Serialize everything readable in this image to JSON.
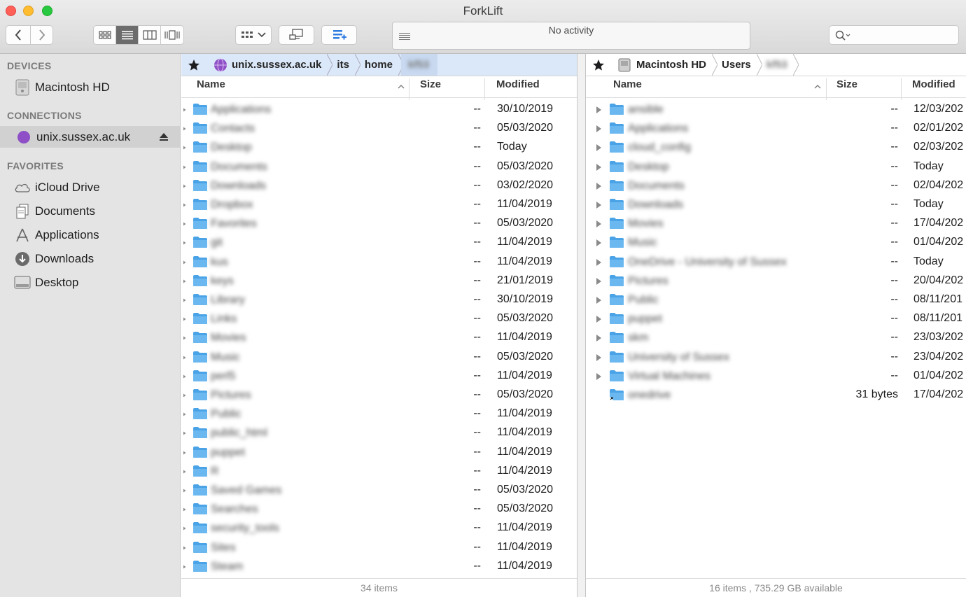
{
  "window": {
    "title": "ForkLift"
  },
  "toolbar": {
    "activity_text": "No activity",
    "search_placeholder": ""
  },
  "sidebar": {
    "sections": [
      {
        "heading": "DEVICES",
        "items": [
          {
            "label": "Macintosh HD",
            "icon": "hard-drive-icon"
          }
        ]
      },
      {
        "heading": "CONNECTIONS",
        "items": [
          {
            "label": "unix.sussex.ac.uk",
            "icon": "globe-icon",
            "selected": true,
            "eject": true
          }
        ]
      },
      {
        "heading": "FAVORITES",
        "items": [
          {
            "label": "iCloud Drive",
            "icon": "cloud-icon"
          },
          {
            "label": "Documents",
            "icon": "documents-icon"
          },
          {
            "label": "Applications",
            "icon": "applications-icon"
          },
          {
            "label": "Downloads",
            "icon": "downloads-icon"
          },
          {
            "label": "Desktop",
            "icon": "desktop-icon"
          }
        ]
      }
    ]
  },
  "left_pane": {
    "path": [
      "unix.sussex.ac.uk",
      "its",
      "home",
      "kf53"
    ],
    "columns": {
      "name": "Name",
      "size": "Size",
      "modified": "Modified"
    },
    "rows": [
      {
        "name": "Applications",
        "size": "--",
        "modified": "30/10/2019"
      },
      {
        "name": "Contacts",
        "size": "--",
        "modified": "05/03/2020"
      },
      {
        "name": "Desktop",
        "size": "--",
        "modified": "Today"
      },
      {
        "name": "Documents",
        "size": "--",
        "modified": "05/03/2020"
      },
      {
        "name": "Downloads",
        "size": "--",
        "modified": "03/02/2020"
      },
      {
        "name": "Dropbox",
        "size": "--",
        "modified": "11/04/2019"
      },
      {
        "name": "Favorites",
        "size": "--",
        "modified": "05/03/2020"
      },
      {
        "name": "git",
        "size": "--",
        "modified": "11/04/2019"
      },
      {
        "name": "kus",
        "size": "--",
        "modified": "11/04/2019"
      },
      {
        "name": "keys",
        "size": "--",
        "modified": "21/01/2019"
      },
      {
        "name": "Library",
        "size": "--",
        "modified": "30/10/2019"
      },
      {
        "name": "Links",
        "size": "--",
        "modified": "05/03/2020"
      },
      {
        "name": "Movies",
        "size": "--",
        "modified": "11/04/2019"
      },
      {
        "name": "Music",
        "size": "--",
        "modified": "05/03/2020"
      },
      {
        "name": "perl5",
        "size": "--",
        "modified": "11/04/2019"
      },
      {
        "name": "Pictures",
        "size": "--",
        "modified": "05/03/2020"
      },
      {
        "name": "Public",
        "size": "--",
        "modified": "11/04/2019"
      },
      {
        "name": "public_html",
        "size": "--",
        "modified": "11/04/2019"
      },
      {
        "name": "puppet",
        "size": "--",
        "modified": "11/04/2019"
      },
      {
        "name": "R",
        "size": "--",
        "modified": "11/04/2019"
      },
      {
        "name": "Saved Games",
        "size": "--",
        "modified": "05/03/2020"
      },
      {
        "name": "Searches",
        "size": "--",
        "modified": "05/03/2020"
      },
      {
        "name": "security_tools",
        "size": "--",
        "modified": "11/04/2019"
      },
      {
        "name": "Sites",
        "size": "--",
        "modified": "11/04/2019"
      },
      {
        "name": "Steam",
        "size": "--",
        "modified": "11/04/2019"
      }
    ],
    "status": "34 items"
  },
  "right_pane": {
    "path": [
      "Macintosh HD",
      "Users",
      "kf53"
    ],
    "columns": {
      "name": "Name",
      "size": "Size",
      "modified": "Modified"
    },
    "rows": [
      {
        "name": "ansible",
        "size": "--",
        "modified": "12/03/202"
      },
      {
        "name": "Applications",
        "size": "--",
        "modified": "02/01/202"
      },
      {
        "name": "cloud_config",
        "size": "--",
        "modified": "02/03/202"
      },
      {
        "name": "Desktop",
        "size": "--",
        "modified": "Today"
      },
      {
        "name": "Documents",
        "size": "--",
        "modified": "02/04/202"
      },
      {
        "name": "Downloads",
        "size": "--",
        "modified": "Today"
      },
      {
        "name": "Movies",
        "size": "--",
        "modified": "17/04/202"
      },
      {
        "name": "Music",
        "size": "--",
        "modified": "01/04/202"
      },
      {
        "name": "OneDrive - University of Sussex",
        "size": "--",
        "modified": "Today"
      },
      {
        "name": "Pictures",
        "size": "--",
        "modified": "20/04/202"
      },
      {
        "name": "Public",
        "size": "--",
        "modified": "08/11/201"
      },
      {
        "name": "puppet",
        "size": "--",
        "modified": "08/11/201"
      },
      {
        "name": "skm",
        "size": "--",
        "modified": "23/03/202"
      },
      {
        "name": "University of Sussex",
        "size": "--",
        "modified": "23/04/202"
      },
      {
        "name": "Virtual Machines",
        "size": "--",
        "modified": "01/04/202"
      },
      {
        "name": "onedrive",
        "size": "31 bytes",
        "modified": "17/04/202",
        "alias": true
      }
    ],
    "status": "16 items , 735.29 GB available"
  },
  "colors": {
    "folder": "#6bb8f0",
    "folder_dark": "#4aa3e6",
    "selected_path_bg": "#dbe8f9",
    "sidebar_bg": "#e4e4e4"
  }
}
